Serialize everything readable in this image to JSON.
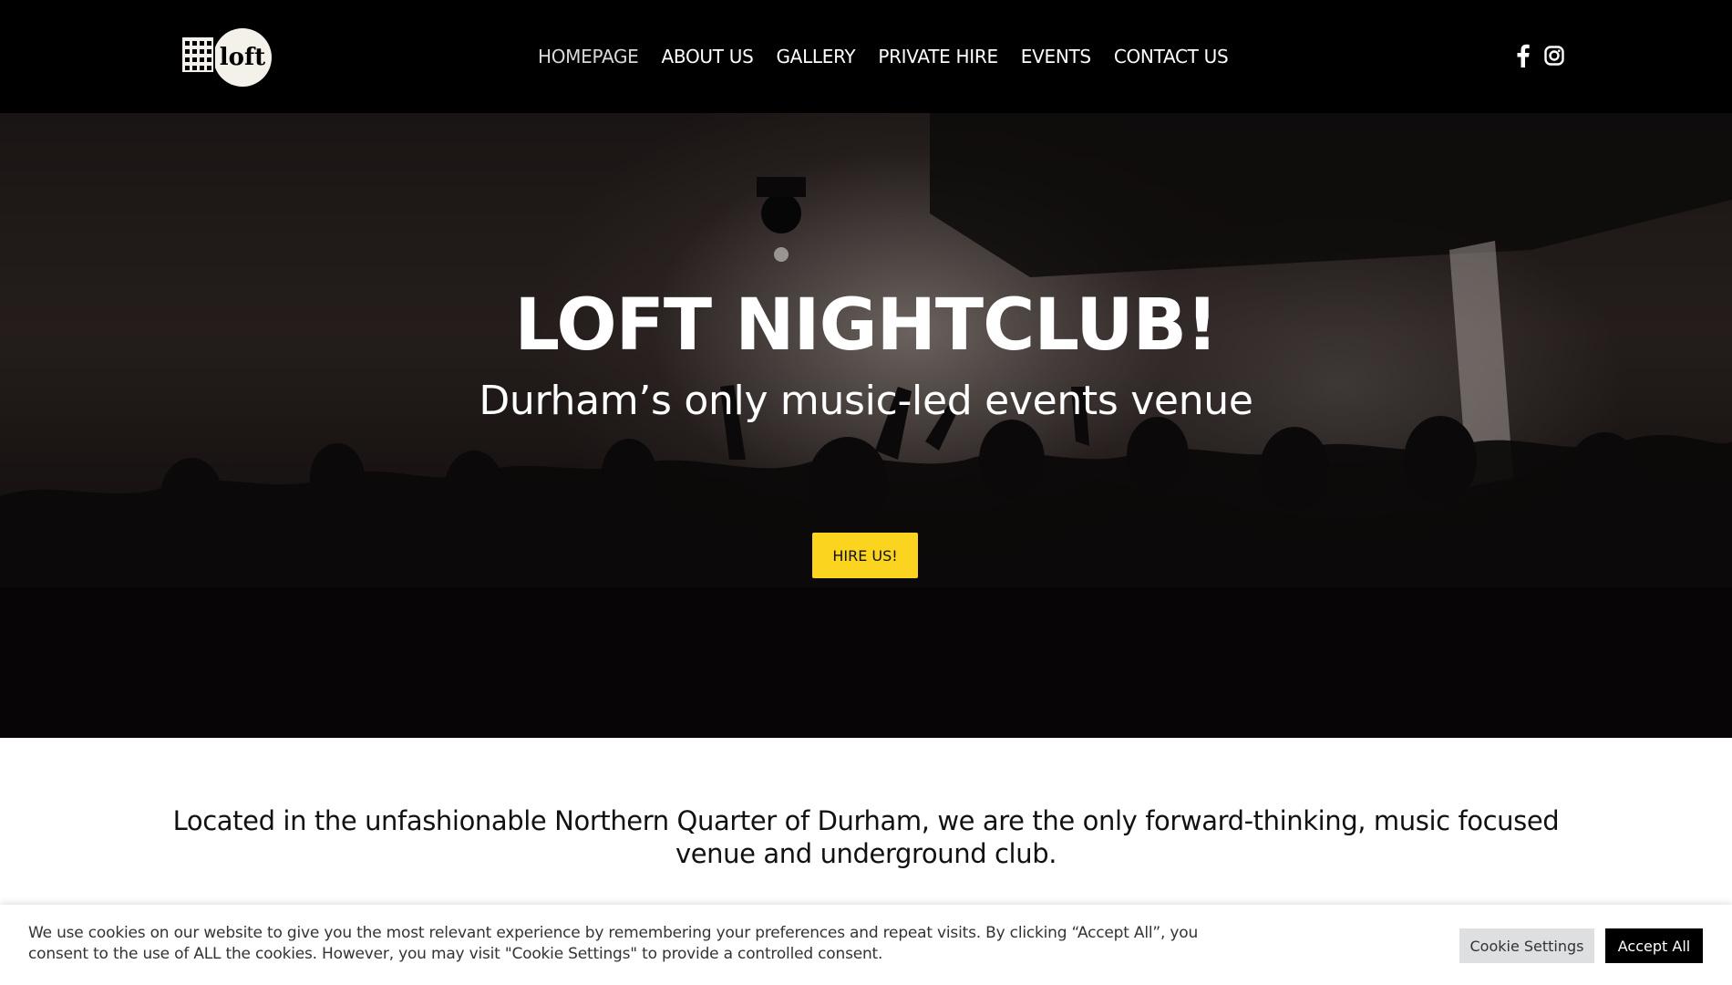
{
  "header": {
    "logo_text": "loft",
    "nav": [
      {
        "label": "HOMEPAGE",
        "active": true
      },
      {
        "label": "ABOUT US"
      },
      {
        "label": "GALLERY"
      },
      {
        "label": "PRIVATE HIRE"
      },
      {
        "label": "EVENTS"
      },
      {
        "label": "CONTACT US"
      }
    ],
    "social_icons": [
      "facebook-icon",
      "instagram-icon"
    ]
  },
  "hero": {
    "title": "LOFT NIGHTCLUB!",
    "subtitle": "Durham’s only music-led events venue",
    "cta_label": "HIRE US!"
  },
  "intro": {
    "text": "Located in the unfashionable Northern Quarter of Durham, we are the only forward-thinking, music focused venue and underground club."
  },
  "cookie_bar": {
    "text": "We use cookies on our website to give you the most relevant experience by remembering your preferences and repeat visits. By clicking “Accept All”, you consent to the use of ALL the cookies. However, you may visit \"Cookie Settings\" to provide a controlled consent.",
    "settings_label": "Cookie Settings",
    "accept_label": "Accept All"
  },
  "colors": {
    "header_bg": "#000000",
    "cta_yellow": "#fbd420",
    "accept_bg": "#000000",
    "settings_bg": "#dedfe0"
  }
}
